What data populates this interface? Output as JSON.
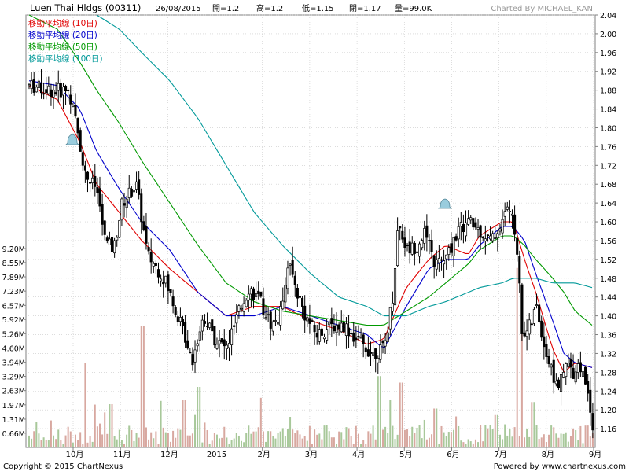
{
  "header": {
    "name": "Luen Thai Hldgs (00311)",
    "date": "26/08/2015",
    "open": "開=1.2",
    "high": "高=1.2",
    "low": "低=1.15",
    "close": "閉=1.17",
    "volume": "量=99.0K",
    "charted_by": "Charted By MICHAEL_KAN"
  },
  "footer": {
    "copyright": "Copyright © 2015 ChartNexus",
    "powered": "Powered by www.chartnexus.com"
  },
  "colors": {
    "ma10": "#e00000",
    "ma20": "#0000cc",
    "ma50": "#009900",
    "ma100": "#009999",
    "up_volume": "#a8c89a",
    "down_volume": "#d8a8a0",
    "candle": "#000000",
    "grid": "#c8c8c8",
    "alert_icon": "#99ccdd"
  },
  "chart_data": {
    "type": "candlestick",
    "title": "Luen Thai Hldgs (00311)",
    "price_axis": {
      "ticks": [
        "2.04",
        "2.00",
        "1.96",
        "1.92",
        "1.88",
        "1.84",
        "1.80",
        "1.76",
        "1.72",
        "1.68",
        "1.64",
        "1.60",
        "1.56",
        "1.52",
        "1.48",
        "1.44",
        "1.40",
        "1.36",
        "1.32",
        "1.28",
        "1.24",
        "1.20",
        "1.16"
      ],
      "ylim": [
        1.12,
        2.04
      ],
      "side": "right"
    },
    "volume_axis": {
      "ticks": [
        "9.20M",
        "8.55M",
        "7.89M",
        "7.23M",
        "6.57M",
        "5.92M",
        "5.26M",
        "4.60M",
        "3.94M",
        "3.29M",
        "2.63M",
        "1.97M",
        "1.31M",
        "0.66M"
      ],
      "ylim": [
        0,
        9.2
      ],
      "unit": "M",
      "side": "left"
    },
    "x_ticks": [
      "10月",
      "11月",
      "12月",
      "2015",
      "2月",
      "3月",
      "4月",
      "5月",
      "6月",
      "7月",
      "8月",
      "9月"
    ],
    "legend": [
      {
        "label": "移動平均線 (10日)",
        "color": "#e00000"
      },
      {
        "label": "移動平均線 (20日)",
        "color": "#0000cc"
      },
      {
        "label": "移動平均線 (50日)",
        "color": "#009900"
      },
      {
        "label": "移動平均線 (100日)",
        "color": "#009999"
      }
    ],
    "legend_position": "top-left",
    "grid": true,
    "ma_lines": {
      "ma10": [
        [
          0.0,
          1.89
        ],
        [
          0.05,
          1.86
        ],
        [
          0.09,
          1.77
        ],
        [
          0.12,
          1.68
        ],
        [
          0.16,
          1.62
        ],
        [
          0.2,
          1.56
        ],
        [
          0.25,
          1.5
        ],
        [
          0.3,
          1.45
        ],
        [
          0.35,
          1.4
        ],
        [
          0.4,
          1.42
        ],
        [
          0.45,
          1.42
        ],
        [
          0.5,
          1.39
        ],
        [
          0.55,
          1.37
        ],
        [
          0.6,
          1.34
        ],
        [
          0.63,
          1.35
        ],
        [
          0.67,
          1.46
        ],
        [
          0.71,
          1.52
        ],
        [
          0.74,
          1.55
        ],
        [
          0.78,
          1.53
        ],
        [
          0.8,
          1.57
        ],
        [
          0.84,
          1.6
        ],
        [
          0.86,
          1.6
        ],
        [
          0.88,
          1.52
        ],
        [
          0.9,
          1.45
        ],
        [
          0.93,
          1.33
        ],
        [
          0.95,
          1.28
        ],
        [
          0.97,
          1.3
        ],
        [
          1.0,
          1.29
        ]
      ],
      "ma20": [
        [
          0.0,
          1.9
        ],
        [
          0.05,
          1.89
        ],
        [
          0.09,
          1.84
        ],
        [
          0.12,
          1.75
        ],
        [
          0.16,
          1.67
        ],
        [
          0.2,
          1.6
        ],
        [
          0.25,
          1.54
        ],
        [
          0.3,
          1.45
        ],
        [
          0.35,
          1.4
        ],
        [
          0.4,
          1.4
        ],
        [
          0.45,
          1.42
        ],
        [
          0.5,
          1.4
        ],
        [
          0.55,
          1.38
        ],
        [
          0.6,
          1.36
        ],
        [
          0.63,
          1.33
        ],
        [
          0.67,
          1.42
        ],
        [
          0.71,
          1.5
        ],
        [
          0.74,
          1.52
        ],
        [
          0.78,
          1.52
        ],
        [
          0.8,
          1.55
        ],
        [
          0.84,
          1.59
        ],
        [
          0.86,
          1.59
        ],
        [
          0.88,
          1.56
        ],
        [
          0.9,
          1.49
        ],
        [
          0.93,
          1.39
        ],
        [
          0.95,
          1.32
        ],
        [
          0.97,
          1.3
        ],
        [
          1.0,
          1.29
        ]
      ],
      "ma50": [
        [
          0.0,
          2.04
        ],
        [
          0.05,
          2.01
        ],
        [
          0.09,
          1.94
        ],
        [
          0.12,
          1.88
        ],
        [
          0.16,
          1.81
        ],
        [
          0.2,
          1.73
        ],
        [
          0.25,
          1.64
        ],
        [
          0.3,
          1.55
        ],
        [
          0.35,
          1.47
        ],
        [
          0.4,
          1.43
        ],
        [
          0.45,
          1.41
        ],
        [
          0.5,
          1.4
        ],
        [
          0.55,
          1.39
        ],
        [
          0.6,
          1.38
        ],
        [
          0.63,
          1.38
        ],
        [
          0.67,
          1.41
        ],
        [
          0.71,
          1.44
        ],
        [
          0.74,
          1.47
        ],
        [
          0.78,
          1.51
        ],
        [
          0.8,
          1.54
        ],
        [
          0.84,
          1.57
        ],
        [
          0.86,
          1.57
        ],
        [
          0.88,
          1.55
        ],
        [
          0.9,
          1.52
        ],
        [
          0.93,
          1.48
        ],
        [
          0.95,
          1.45
        ],
        [
          0.97,
          1.41
        ],
        [
          1.0,
          1.38
        ]
      ],
      "ma100": [
        [
          0.12,
          2.04
        ],
        [
          0.16,
          2.01
        ],
        [
          0.2,
          1.96
        ],
        [
          0.25,
          1.9
        ],
        [
          0.3,
          1.82
        ],
        [
          0.35,
          1.72
        ],
        [
          0.4,
          1.62
        ],
        [
          0.45,
          1.55
        ],
        [
          0.5,
          1.49
        ],
        [
          0.55,
          1.44
        ],
        [
          0.6,
          1.42
        ],
        [
          0.63,
          1.4
        ],
        [
          0.67,
          1.4
        ],
        [
          0.71,
          1.42
        ],
        [
          0.74,
          1.43
        ],
        [
          0.78,
          1.45
        ],
        [
          0.8,
          1.46
        ],
        [
          0.84,
          1.47
        ],
        [
          0.86,
          1.48
        ],
        [
          0.88,
          1.48
        ],
        [
          0.9,
          1.48
        ],
        [
          0.93,
          1.47
        ],
        [
          0.95,
          1.47
        ],
        [
          0.97,
          1.47
        ],
        [
          1.0,
          1.46
        ]
      ]
    },
    "price_waypoints": [
      [
        0,
        1.89
      ],
      [
        0.04,
        1.88
      ],
      [
        0.07,
        1.88
      ],
      [
        0.085,
        1.8
      ],
      [
        0.1,
        1.7
      ],
      [
        0.12,
        1.67
      ],
      [
        0.135,
        1.56
      ],
      [
        0.15,
        1.54
      ],
      [
        0.165,
        1.64
      ],
      [
        0.19,
        1.68
      ],
      [
        0.21,
        1.53
      ],
      [
        0.24,
        1.48
      ],
      [
        0.27,
        1.38
      ],
      [
        0.29,
        1.31
      ],
      [
        0.31,
        1.4
      ],
      [
        0.33,
        1.35
      ],
      [
        0.35,
        1.33
      ],
      [
        0.37,
        1.4
      ],
      [
        0.39,
        1.46
      ],
      [
        0.41,
        1.43
      ],
      [
        0.43,
        1.38
      ],
      [
        0.445,
        1.4
      ],
      [
        0.46,
        1.52
      ],
      [
        0.47,
        1.47
      ],
      [
        0.49,
        1.4
      ],
      [
        0.51,
        1.36
      ],
      [
        0.54,
        1.38
      ],
      [
        0.56,
        1.38
      ],
      [
        0.58,
        1.35
      ],
      [
        0.61,
        1.32
      ],
      [
        0.63,
        1.33
      ],
      [
        0.645,
        1.44
      ],
      [
        0.655,
        1.6
      ],
      [
        0.67,
        1.54
      ],
      [
        0.69,
        1.55
      ],
      [
        0.7,
        1.58
      ],
      [
        0.72,
        1.51
      ],
      [
        0.74,
        1.52
      ],
      [
        0.76,
        1.58
      ],
      [
        0.78,
        1.6
      ],
      [
        0.8,
        1.58
      ],
      [
        0.82,
        1.56
      ],
      [
        0.84,
        1.6
      ],
      [
        0.85,
        1.64
      ],
      [
        0.865,
        1.56
      ],
      [
        0.875,
        1.36
      ],
      [
        0.89,
        1.38
      ],
      [
        0.9,
        1.42
      ],
      [
        0.915,
        1.33
      ],
      [
        0.93,
        1.27
      ],
      [
        0.94,
        1.25
      ],
      [
        0.955,
        1.3
      ],
      [
        0.965,
        1.28
      ],
      [
        0.975,
        1.3
      ],
      [
        0.99,
        1.25
      ],
      [
        1.0,
        1.17
      ]
    ],
    "volume_spikes": [
      [
        0.1,
        3.9
      ],
      [
        0.145,
        2.0
      ],
      [
        0.2,
        5.6
      ],
      [
        0.275,
        2.2
      ],
      [
        0.3,
        2.8
      ],
      [
        0.62,
        3.3
      ],
      [
        0.64,
        2.2
      ],
      [
        0.66,
        3.0
      ],
      [
        0.72,
        1.8
      ],
      [
        0.83,
        1.5
      ],
      [
        0.865,
        8.3
      ],
      [
        0.875,
        5.9
      ],
      [
        0.895,
        2.1
      ],
      [
        0.97,
        0.8
      ]
    ],
    "last_price": 1.17
  }
}
